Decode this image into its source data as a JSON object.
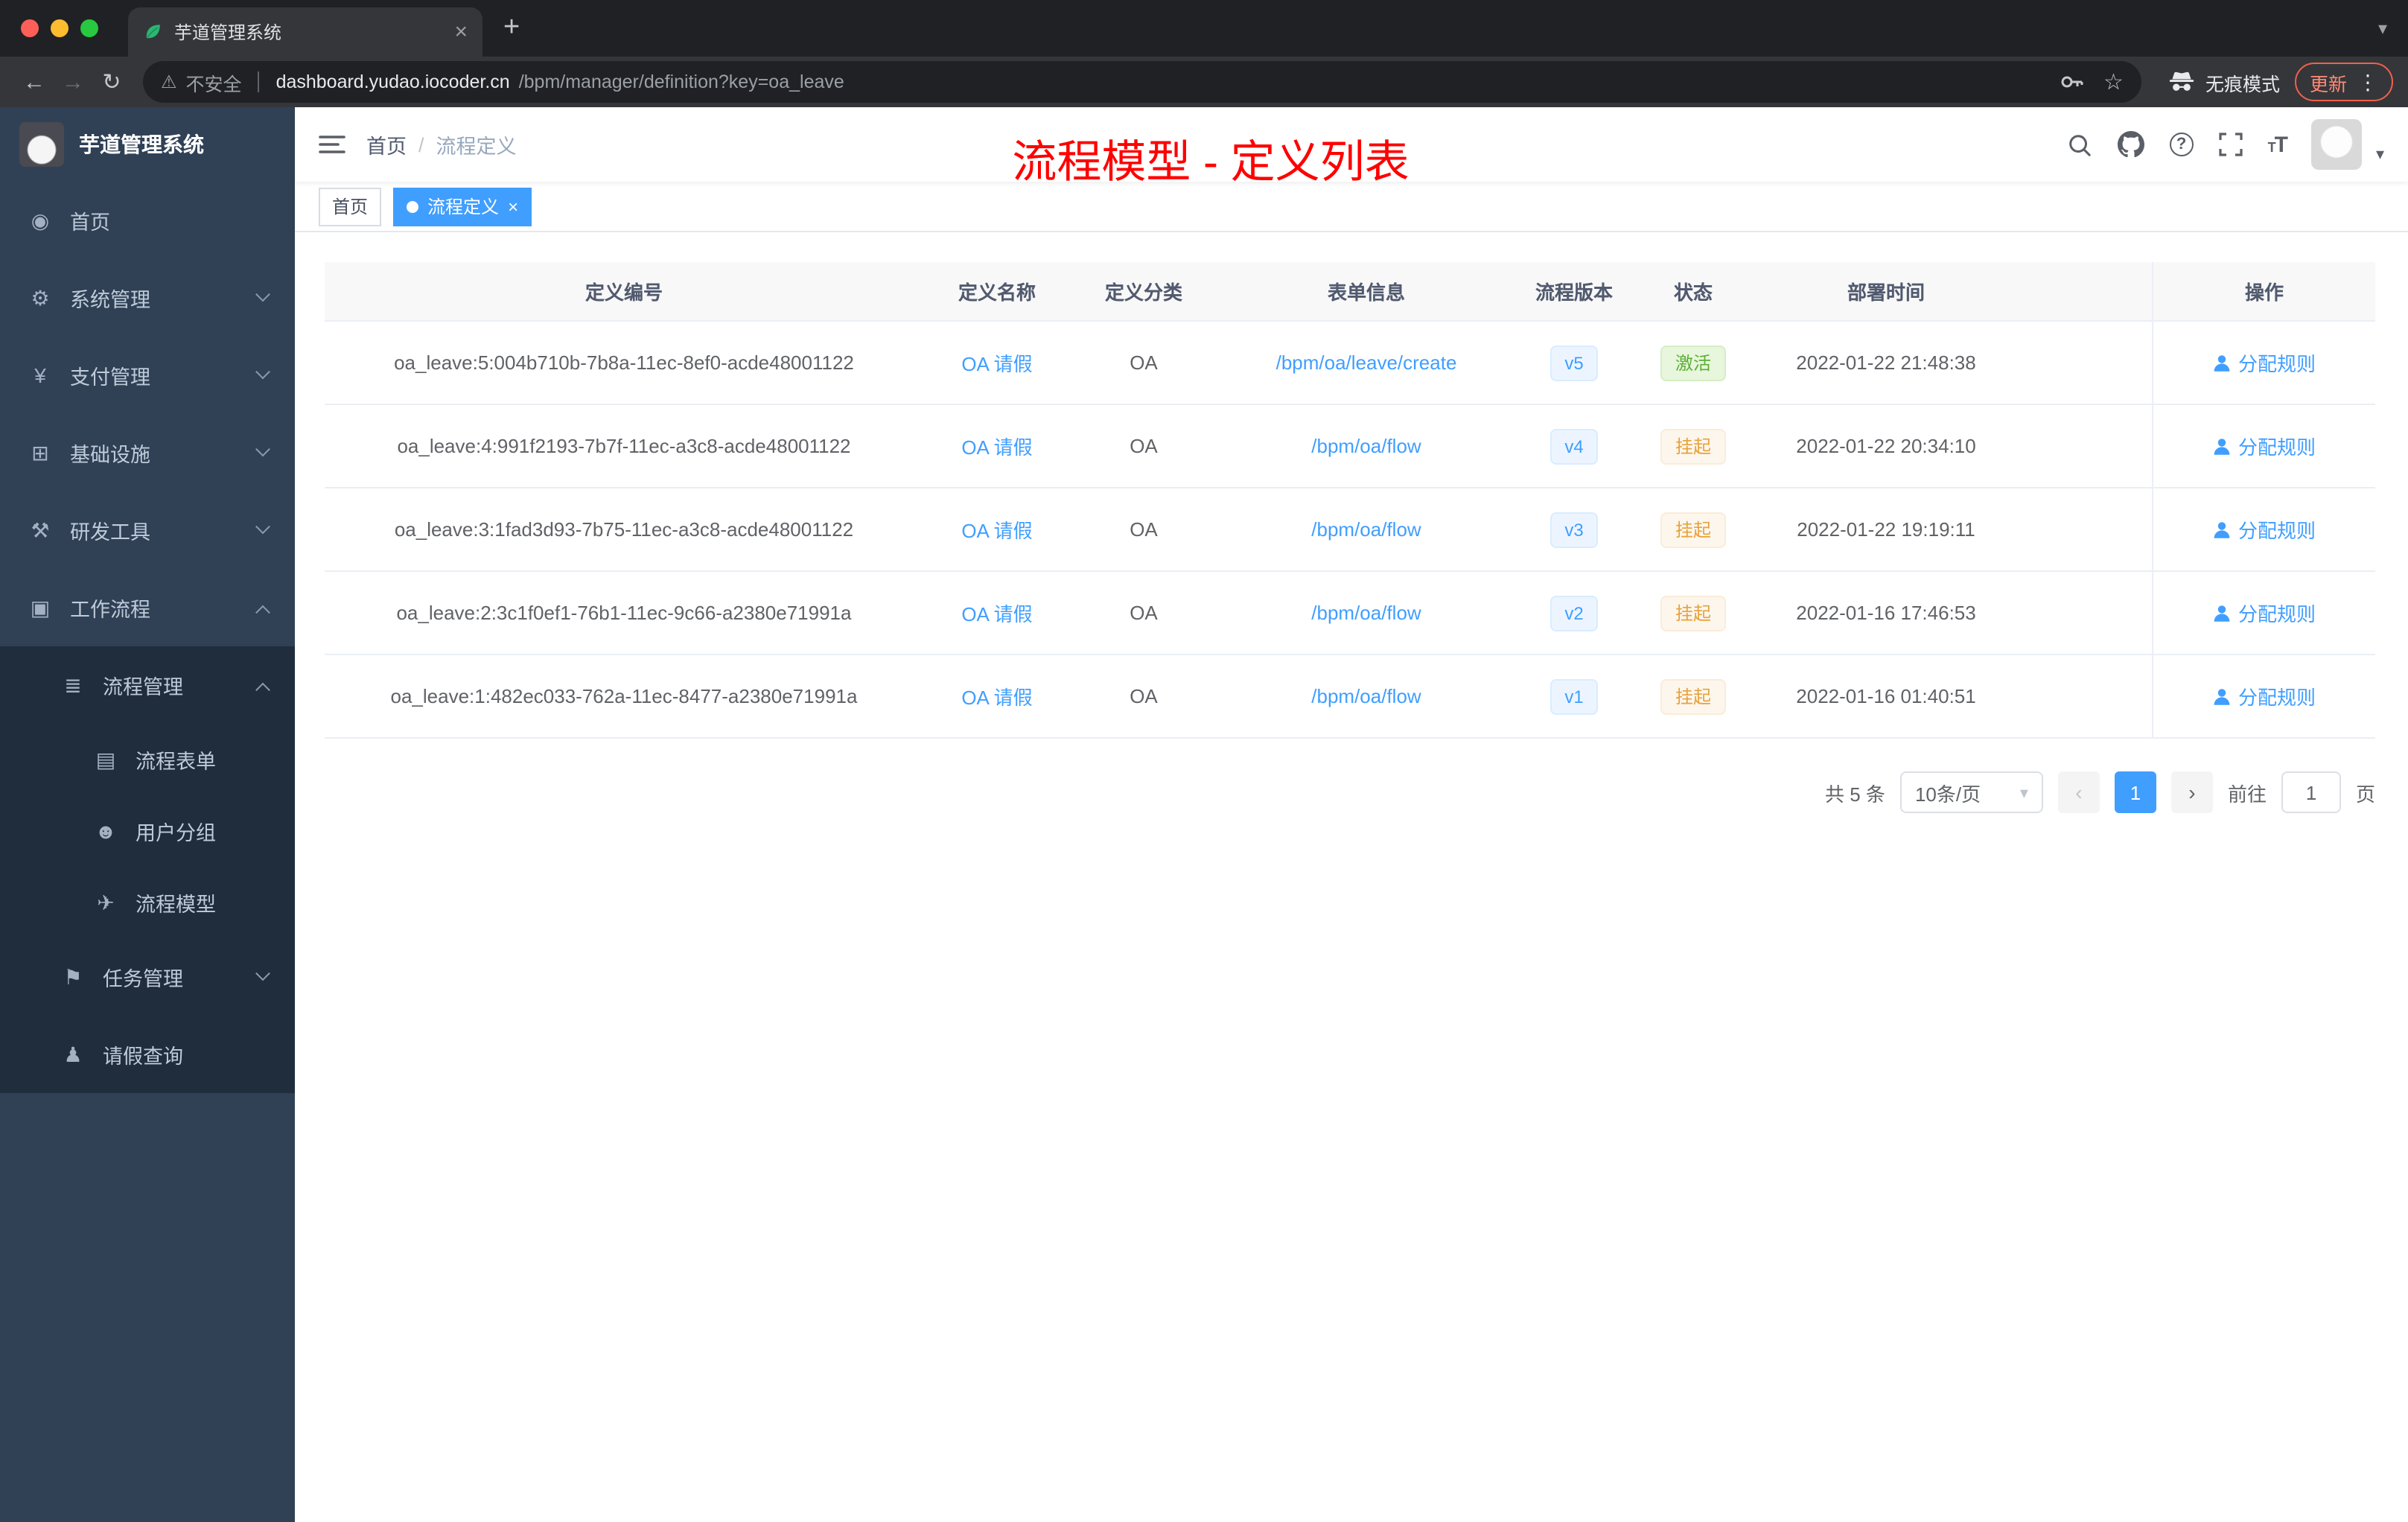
{
  "browser": {
    "tab_title": "芋道管理系统",
    "security_label": "不安全",
    "url_host": "dashboard.yudao.iocoder.cn",
    "url_path": "/bpm/manager/definition?key=oa_leave",
    "incognito_label": "无痕模式",
    "update_label": "更新"
  },
  "header": {
    "breadcrumb": [
      "首页",
      "流程定义"
    ],
    "separator": "/",
    "annotation": "流程模型 - 定义列表"
  },
  "tags": {
    "home": "首页",
    "current": "流程定义"
  },
  "sidebar": {
    "logo_title": "芋道管理系统",
    "menu": [
      {
        "label": "首页",
        "icon": "home-icon",
        "glyph": "◉"
      },
      {
        "label": "系统管理",
        "icon": "system-gear-icon",
        "glyph": "⚙",
        "chevron": "down"
      },
      {
        "label": "支付管理",
        "icon": "payment-icon",
        "glyph": "¥",
        "chevron": "down"
      },
      {
        "label": "基础设施",
        "icon": "infrastructure-icon",
        "glyph": "⊞",
        "chevron": "down"
      },
      {
        "label": "研发工具",
        "icon": "devtools-icon",
        "glyph": "⚒",
        "chevron": "down"
      },
      {
        "label": "工作流程",
        "icon": "workflow-icon",
        "glyph": "▣",
        "chevron": "up"
      }
    ],
    "process_group": {
      "label": "流程管理",
      "icon": "process-management-icon",
      "glyph": "≣",
      "chevron": "up"
    },
    "process_children": [
      {
        "label": "流程表单",
        "icon": "process-form-icon",
        "glyph": "▤"
      },
      {
        "label": "用户分组",
        "icon": "user-group-icon",
        "glyph": "☻"
      },
      {
        "label": "流程模型",
        "icon": "process-model-icon",
        "glyph": "✈"
      }
    ],
    "other_items": [
      {
        "label": "任务管理",
        "icon": "task-management-icon",
        "glyph": "⚑",
        "chevron": "down"
      },
      {
        "label": "请假查询",
        "icon": "leave-query-icon",
        "glyph": "♟"
      }
    ]
  },
  "table": {
    "columns": [
      "定义编号",
      "定义名称",
      "定义分类",
      "表单信息",
      "流程版本",
      "状态",
      "部署时间",
      "操作"
    ],
    "action_label": "分配规则",
    "rows": [
      {
        "id": "oa_leave:5:004b710b-7b8a-11ec-8ef0-acde48001122",
        "name": "OA 请假",
        "category": "OA",
        "form": "/bpm/oa/leave/create",
        "version": "v5",
        "status": "激活",
        "status_type": "success",
        "time": "2022-01-22 21:48:38"
      },
      {
        "id": "oa_leave:4:991f2193-7b7f-11ec-a3c8-acde48001122",
        "name": "OA 请假",
        "category": "OA",
        "form": "/bpm/oa/flow",
        "version": "v4",
        "status": "挂起",
        "status_type": "warning",
        "time": "2022-01-22 20:34:10"
      },
      {
        "id": "oa_leave:3:1fad3d93-7b75-11ec-a3c8-acde48001122",
        "name": "OA 请假",
        "category": "OA",
        "form": "/bpm/oa/flow",
        "version": "v3",
        "status": "挂起",
        "status_type": "warning",
        "time": "2022-01-22 19:19:11"
      },
      {
        "id": "oa_leave:2:3c1f0ef1-76b1-11ec-9c66-a2380e71991a",
        "name": "OA 请假",
        "category": "OA",
        "form": "/bpm/oa/flow",
        "version": "v2",
        "status": "挂起",
        "status_type": "warning",
        "time": "2022-01-16 17:46:53"
      },
      {
        "id": "oa_leave:1:482ec033-762a-11ec-8477-a2380e71991a",
        "name": "OA 请假",
        "category": "OA",
        "form": "/bpm/oa/flow",
        "version": "v1",
        "status": "挂起",
        "status_type": "warning",
        "time": "2022-01-16 01:40:51"
      }
    ]
  },
  "pagination": {
    "total": "共 5 条",
    "page_size": "10条/页",
    "current_page": "1",
    "goto_label": "前往",
    "goto_value": "1",
    "page_unit": "页"
  },
  "colors": {
    "accent": "#409eff",
    "success": "#67c23a",
    "warning": "#e6a23c",
    "annotation": "#ff0000",
    "sidebar_bg": "#304156",
    "submenu_bg": "#1f2d3d"
  }
}
